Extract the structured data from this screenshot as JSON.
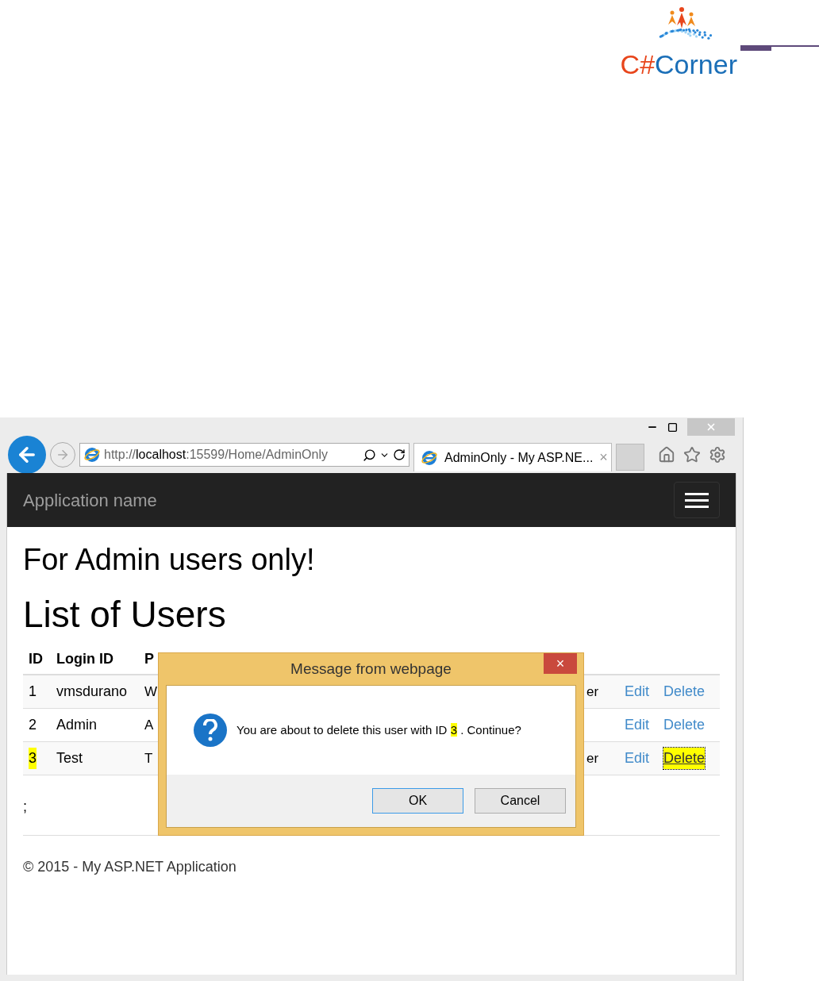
{
  "logo": {
    "prefix": "C#",
    "name": "Corner"
  },
  "browser": {
    "address": {
      "scheme": "http://",
      "host": "localhost",
      "rest": ":15599/Home/AdminOnly"
    },
    "tab": {
      "title": "AdminOnly - My ASP.NE...",
      "close": "×"
    }
  },
  "site": {
    "brand": "Application name",
    "heading": "For Admin users only!",
    "subheading": "List of Users",
    "stray_text": ";",
    "footer": "© 2015 - My ASP.NET Application"
  },
  "table": {
    "columns": [
      "ID",
      "Login ID",
      "P"
    ],
    "rows": [
      {
        "id": "1",
        "login": "vmsdurano",
        "column_3": "W",
        "column_4": "er",
        "highlighted": false,
        "actions": [
          {
            "label": "Edit",
            "focused": false
          },
          {
            "label": "Delete",
            "focused": false
          }
        ]
      },
      {
        "id": "2",
        "login": "Admin",
        "column_3": "A",
        "highlighted": false,
        "actions": [
          {
            "label": "Edit",
            "focused": false
          },
          {
            "label": "Delete",
            "focused": false
          }
        ]
      },
      {
        "id": "3",
        "login": "Test",
        "column_3": "T",
        "column_4": "er",
        "highlighted": true,
        "actions": [
          {
            "label": "Edit",
            "focused": false
          },
          {
            "label": "Delete",
            "focused": true
          }
        ]
      }
    ]
  },
  "dialog": {
    "title": "Message from webpage",
    "close": "×",
    "message_before": "You are about to delete this user with ID",
    "message_id": "3",
    "message_after": ". Continue?",
    "buttons": [
      {
        "label": "OK",
        "selected": true
      },
      {
        "label": "Cancel",
        "selected": false
      }
    ]
  }
}
